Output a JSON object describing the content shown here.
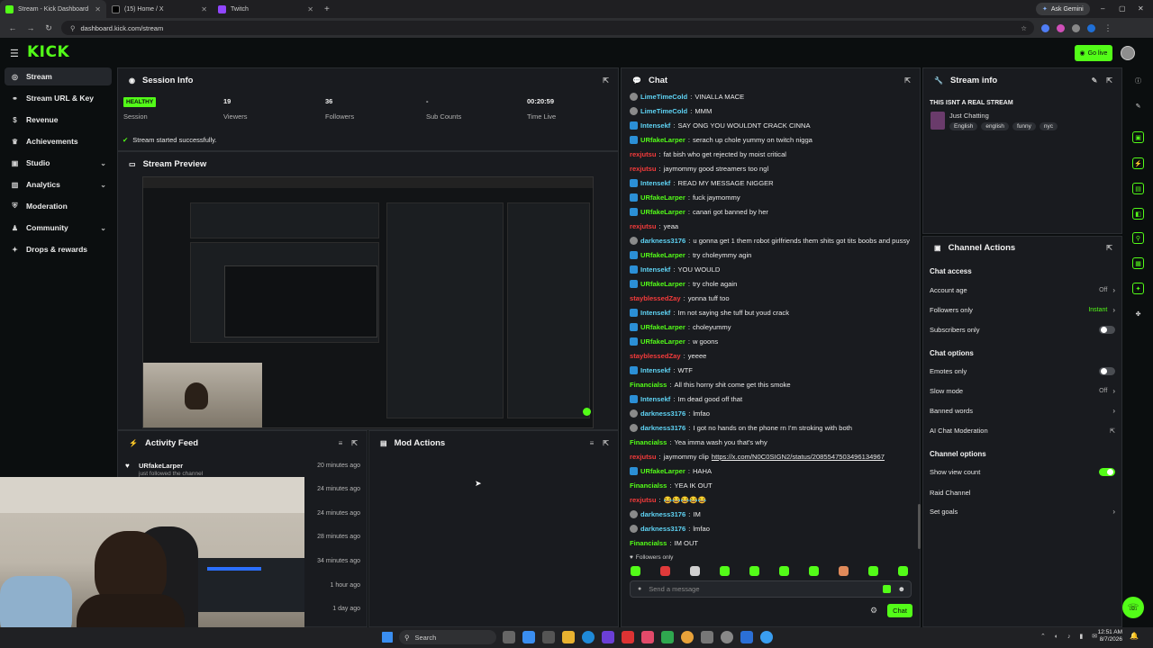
{
  "browser": {
    "tabs": [
      {
        "title": "Stream - Kick Dashboard",
        "active": true
      },
      {
        "title": "(15) Home / X",
        "active": false
      },
      {
        "title": "Twitch",
        "active": false
      }
    ],
    "ask_gemini": "Ask Gemini",
    "url": "dashboard.kick.com/stream"
  },
  "header": {
    "logo": "KICK",
    "go_live": "Go live"
  },
  "sidebar": {
    "items": [
      {
        "label": "Stream",
        "icon": "broadcast-icon",
        "active": true
      },
      {
        "label": "Stream URL & Key",
        "icon": "link-icon"
      },
      {
        "label": "Revenue",
        "icon": "dollar-icon"
      },
      {
        "label": "Achievements",
        "icon": "trophy-icon"
      },
      {
        "label": "Studio",
        "icon": "video-icon",
        "expand": true
      },
      {
        "label": "Analytics",
        "icon": "chart-icon",
        "expand": true
      },
      {
        "label": "Moderation",
        "icon": "shield-icon"
      },
      {
        "label": "Community",
        "icon": "people-icon",
        "expand": true
      },
      {
        "label": "Drops & rewards",
        "icon": "gift-icon"
      }
    ]
  },
  "session": {
    "title": "Session Info",
    "status_badge": "HEALTHY",
    "status_label": "Session",
    "viewers": "19",
    "viewers_label": "Viewers",
    "followers": "36",
    "followers_label": "Followers",
    "subs": "-",
    "subs_label": "Sub Counts",
    "time_live": "00:20:59",
    "time_live_label": "Time Live",
    "success_msg": "Stream started successfully."
  },
  "preview": {
    "title": "Stream Preview"
  },
  "activity": {
    "title": "Activity Feed",
    "items": [
      {
        "user": "URfakeLarper",
        "text": "just followed the channel",
        "time": "20 minutes ago"
      },
      {
        "time": "24 minutes ago"
      },
      {
        "time": "24 minutes ago"
      },
      {
        "time": "28 minutes ago"
      },
      {
        "time": "34 minutes ago"
      },
      {
        "time": "1 hour ago"
      },
      {
        "time": "1 day ago"
      }
    ]
  },
  "mod_actions": {
    "title": "Mod Actions"
  },
  "chat": {
    "title": "Chat",
    "messages": [
      {
        "user": "LimeTimeCold",
        "color": "#5fd4f5",
        "text": "VINALLA MACE",
        "badge": "#8a8a8a"
      },
      {
        "user": "LimeTimeCold",
        "color": "#5fd4f5",
        "text": "MMM",
        "badge": "#8a8a8a"
      },
      {
        "user": "Intensekf",
        "color": "#5fd4f5",
        "text": "SAY ONG YOU WOULDNT CRACK CINNA",
        "badge": "#2b8fd6"
      },
      {
        "user": "URfakeLarper",
        "color": "#53fc18",
        "text": "serach up chole yummy on twitch nigga",
        "badge": "#2b8fd6"
      },
      {
        "user": "rexjutsu",
        "color": "#f53b3b",
        "text": "fat bish who get rejected by moist critical",
        "badge": ""
      },
      {
        "user": "rexjutsu",
        "color": "#f53b3b",
        "text": "jaymommy good streamers too ngl",
        "badge": ""
      },
      {
        "user": "Intensekf",
        "color": "#5fd4f5",
        "text": "READ MY MESSAGE NIGGER",
        "badge": "#2b8fd6"
      },
      {
        "user": "URfakeLarper",
        "color": "#53fc18",
        "text": "fuck jaymommy",
        "badge": "#2b8fd6"
      },
      {
        "user": "URfakeLarper",
        "color": "#53fc18",
        "text": "canari got banned by her",
        "badge": "#2b8fd6"
      },
      {
        "user": "rexjutsu",
        "color": "#f53b3b",
        "text": "yeaa",
        "badge": ""
      },
      {
        "user": "darkness3176",
        "color": "#5fd4f5",
        "text": "u gonna get 1 them robot girlfriends them shits got tits boobs and pussy",
        "badge": "#8a8a8a"
      },
      {
        "user": "URfakeLarper",
        "color": "#53fc18",
        "text": "try choleymmy agin",
        "badge": "#2b8fd6"
      },
      {
        "user": "Intensekf",
        "color": "#5fd4f5",
        "text": "YOU WOULD",
        "badge": "#2b8fd6"
      },
      {
        "user": "URfakeLarper",
        "color": "#53fc18",
        "text": "try chole again",
        "badge": "#2b8fd6"
      },
      {
        "user": "stayblessedZay",
        "color": "#f53b3b",
        "text": "yonna tuff too",
        "badge": ""
      },
      {
        "user": "Intensekf",
        "color": "#5fd4f5",
        "text": "Im not saying she tuff but youd crack",
        "badge": "#2b8fd6"
      },
      {
        "user": "URfakeLarper",
        "color": "#53fc18",
        "text": "choleyummy",
        "badge": "#2b8fd6"
      },
      {
        "user": "URfakeLarper",
        "color": "#53fc18",
        "text": "w goons",
        "badge": "#2b8fd6"
      },
      {
        "user": "stayblessedZay",
        "color": "#f53b3b",
        "text": "yeeee",
        "badge": ""
      },
      {
        "user": "Intensekf",
        "color": "#5fd4f5",
        "text": "WTF",
        "badge": "#2b8fd6"
      },
      {
        "user": "Financialss",
        "color": "#53fc18",
        "text": "All this horny shit come get this smoke",
        "badge": ""
      },
      {
        "user": "Intensekf",
        "color": "#5fd4f5",
        "text": "Im dead good off that",
        "badge": "#2b8fd6"
      },
      {
        "user": "darkness3176",
        "color": "#5fd4f5",
        "text": "lmfao",
        "badge": "#8a8a8a"
      },
      {
        "user": "darkness3176",
        "color": "#5fd4f5",
        "text": "I got no hands on the phone rn I'm stroking with both",
        "badge": "#8a8a8a"
      },
      {
        "user": "Financialss",
        "color": "#53fc18",
        "text": "Yea imma wash you that's why",
        "badge": ""
      },
      {
        "user": "rexjutsu",
        "color": "#f53b3b",
        "text": "jaymommy clip ",
        "link": "https://x.com/N0C0SIGN2/status/2085547503496134967",
        "badge": ""
      },
      {
        "user": "URfakeLarper",
        "color": "#53fc18",
        "text": "HAHA",
        "badge": "#2b8fd6"
      },
      {
        "user": "Financialss",
        "color": "#53fc18",
        "text": "YEA IK OUT",
        "badge": ""
      },
      {
        "user": "rexjutsu",
        "color": "#f53b3b",
        "text": "😂😂😂😂😂",
        "badge": ""
      },
      {
        "user": "darkness3176",
        "color": "#5fd4f5",
        "text": "IM",
        "badge": "#8a8a8a"
      },
      {
        "user": "darkness3176",
        "color": "#5fd4f5",
        "text": "lmfao",
        "badge": "#8a8a8a"
      },
      {
        "user": "Financialss",
        "color": "#53fc18",
        "text": "IM OUT",
        "badge": ""
      }
    ],
    "followers_only": "Followers only",
    "placeholder": "Send a message",
    "send_label": "Chat"
  },
  "stream_info": {
    "title": "Stream info",
    "stream_title": "THIS ISNT A REAL STREAM",
    "category": "Just Chatting",
    "tags": [
      "English",
      "english",
      "funny",
      "nyc"
    ]
  },
  "channel_actions": {
    "title": "Channel Actions",
    "chat_access": "Chat access",
    "account_age": "Account age",
    "account_age_val": "Off",
    "followers_only": "Followers only",
    "followers_only_val": "Instant",
    "subscribers_only": "Subscribers only",
    "chat_options": "Chat options",
    "emotes_only": "Emotes only",
    "slow_mode": "Slow mode",
    "slow_mode_val": "Off",
    "banned_words": "Banned words",
    "ai_moderation": "AI Chat Moderation",
    "channel_options": "Channel options",
    "show_view_count": "Show view count",
    "raid_channel": "Raid Channel",
    "set_goals": "Set goals"
  },
  "taskbar": {
    "search": "Search",
    "time": "12:51 AM",
    "date": "8/7/2026"
  },
  "colors": {
    "accent": "#53fc18",
    "panel": "#191b1f",
    "bg": "#0b0e0f"
  }
}
